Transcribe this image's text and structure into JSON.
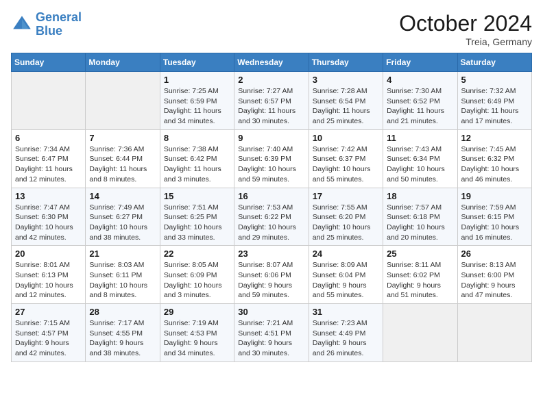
{
  "header": {
    "logo_line1": "General",
    "logo_line2": "Blue",
    "month_title": "October 2024",
    "subtitle": "Treia, Germany"
  },
  "days_of_week": [
    "Sunday",
    "Monday",
    "Tuesday",
    "Wednesday",
    "Thursday",
    "Friday",
    "Saturday"
  ],
  "weeks": [
    [
      {
        "day": "",
        "info": ""
      },
      {
        "day": "",
        "info": ""
      },
      {
        "day": "1",
        "info": "Sunrise: 7:25 AM\nSunset: 6:59 PM\nDaylight: 11 hours and 34 minutes."
      },
      {
        "day": "2",
        "info": "Sunrise: 7:27 AM\nSunset: 6:57 PM\nDaylight: 11 hours and 30 minutes."
      },
      {
        "day": "3",
        "info": "Sunrise: 7:28 AM\nSunset: 6:54 PM\nDaylight: 11 hours and 25 minutes."
      },
      {
        "day": "4",
        "info": "Sunrise: 7:30 AM\nSunset: 6:52 PM\nDaylight: 11 hours and 21 minutes."
      },
      {
        "day": "5",
        "info": "Sunrise: 7:32 AM\nSunset: 6:49 PM\nDaylight: 11 hours and 17 minutes."
      }
    ],
    [
      {
        "day": "6",
        "info": "Sunrise: 7:34 AM\nSunset: 6:47 PM\nDaylight: 11 hours and 12 minutes."
      },
      {
        "day": "7",
        "info": "Sunrise: 7:36 AM\nSunset: 6:44 PM\nDaylight: 11 hours and 8 minutes."
      },
      {
        "day": "8",
        "info": "Sunrise: 7:38 AM\nSunset: 6:42 PM\nDaylight: 11 hours and 3 minutes."
      },
      {
        "day": "9",
        "info": "Sunrise: 7:40 AM\nSunset: 6:39 PM\nDaylight: 10 hours and 59 minutes."
      },
      {
        "day": "10",
        "info": "Sunrise: 7:42 AM\nSunset: 6:37 PM\nDaylight: 10 hours and 55 minutes."
      },
      {
        "day": "11",
        "info": "Sunrise: 7:43 AM\nSunset: 6:34 PM\nDaylight: 10 hours and 50 minutes."
      },
      {
        "day": "12",
        "info": "Sunrise: 7:45 AM\nSunset: 6:32 PM\nDaylight: 10 hours and 46 minutes."
      }
    ],
    [
      {
        "day": "13",
        "info": "Sunrise: 7:47 AM\nSunset: 6:30 PM\nDaylight: 10 hours and 42 minutes."
      },
      {
        "day": "14",
        "info": "Sunrise: 7:49 AM\nSunset: 6:27 PM\nDaylight: 10 hours and 38 minutes."
      },
      {
        "day": "15",
        "info": "Sunrise: 7:51 AM\nSunset: 6:25 PM\nDaylight: 10 hours and 33 minutes."
      },
      {
        "day": "16",
        "info": "Sunrise: 7:53 AM\nSunset: 6:22 PM\nDaylight: 10 hours and 29 minutes."
      },
      {
        "day": "17",
        "info": "Sunrise: 7:55 AM\nSunset: 6:20 PM\nDaylight: 10 hours and 25 minutes."
      },
      {
        "day": "18",
        "info": "Sunrise: 7:57 AM\nSunset: 6:18 PM\nDaylight: 10 hours and 20 minutes."
      },
      {
        "day": "19",
        "info": "Sunrise: 7:59 AM\nSunset: 6:15 PM\nDaylight: 10 hours and 16 minutes."
      }
    ],
    [
      {
        "day": "20",
        "info": "Sunrise: 8:01 AM\nSunset: 6:13 PM\nDaylight: 10 hours and 12 minutes."
      },
      {
        "day": "21",
        "info": "Sunrise: 8:03 AM\nSunset: 6:11 PM\nDaylight: 10 hours and 8 minutes."
      },
      {
        "day": "22",
        "info": "Sunrise: 8:05 AM\nSunset: 6:09 PM\nDaylight: 10 hours and 3 minutes."
      },
      {
        "day": "23",
        "info": "Sunrise: 8:07 AM\nSunset: 6:06 PM\nDaylight: 9 hours and 59 minutes."
      },
      {
        "day": "24",
        "info": "Sunrise: 8:09 AM\nSunset: 6:04 PM\nDaylight: 9 hours and 55 minutes."
      },
      {
        "day": "25",
        "info": "Sunrise: 8:11 AM\nSunset: 6:02 PM\nDaylight: 9 hours and 51 minutes."
      },
      {
        "day": "26",
        "info": "Sunrise: 8:13 AM\nSunset: 6:00 PM\nDaylight: 9 hours and 47 minutes."
      }
    ],
    [
      {
        "day": "27",
        "info": "Sunrise: 7:15 AM\nSunset: 4:57 PM\nDaylight: 9 hours and 42 minutes."
      },
      {
        "day": "28",
        "info": "Sunrise: 7:17 AM\nSunset: 4:55 PM\nDaylight: 9 hours and 38 minutes."
      },
      {
        "day": "29",
        "info": "Sunrise: 7:19 AM\nSunset: 4:53 PM\nDaylight: 9 hours and 34 minutes."
      },
      {
        "day": "30",
        "info": "Sunrise: 7:21 AM\nSunset: 4:51 PM\nDaylight: 9 hours and 30 minutes."
      },
      {
        "day": "31",
        "info": "Sunrise: 7:23 AM\nSunset: 4:49 PM\nDaylight: 9 hours and 26 minutes."
      },
      {
        "day": "",
        "info": ""
      },
      {
        "day": "",
        "info": ""
      }
    ]
  ]
}
